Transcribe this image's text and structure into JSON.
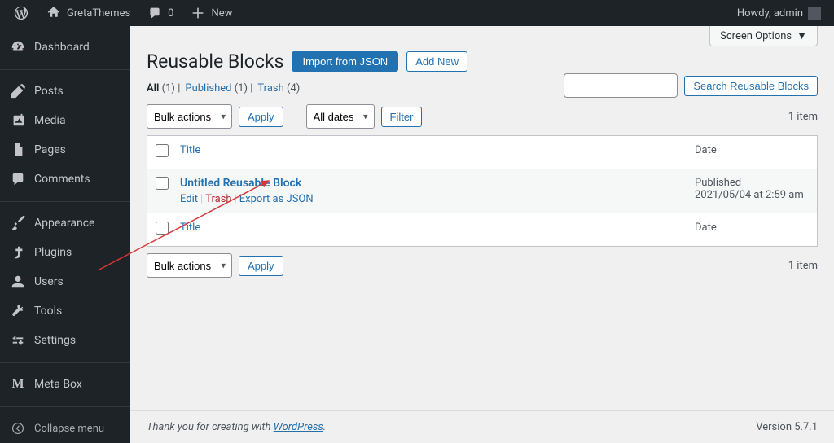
{
  "adminbar": {
    "site": "GretaThemes",
    "comments": "0",
    "new": "New",
    "howdy": "Howdy, admin"
  },
  "sidebar": {
    "items": [
      {
        "icon": "dashboard",
        "label": "Dashboard"
      },
      {
        "icon": "posts",
        "label": "Posts"
      },
      {
        "icon": "media",
        "label": "Media"
      },
      {
        "icon": "pages",
        "label": "Pages"
      },
      {
        "icon": "comments",
        "label": "Comments"
      },
      {
        "icon": "appearance",
        "label": "Appearance"
      },
      {
        "icon": "plugins",
        "label": "Plugins"
      },
      {
        "icon": "users",
        "label": "Users"
      },
      {
        "icon": "tools",
        "label": "Tools"
      },
      {
        "icon": "settings",
        "label": "Settings"
      },
      {
        "icon": "metabox",
        "label": "Meta Box"
      }
    ],
    "collapse": "Collapse menu"
  },
  "screen_options": "Screen Options",
  "page": {
    "title": "Reusable Blocks",
    "import_btn": "Import from JSON",
    "add_new_btn": "Add New"
  },
  "search": {
    "button": "Search Reusable Blocks"
  },
  "views": {
    "all": "All",
    "all_count": "(1)",
    "published": "Published",
    "published_count": "(1)",
    "trash": "Trash",
    "trash_count": "(4)"
  },
  "bulk": {
    "label": "Bulk actions",
    "apply": "Apply"
  },
  "dates": {
    "all": "All dates"
  },
  "filter_btn": "Filter",
  "item_count": "1 item",
  "table": {
    "col_title": "Title",
    "col_date": "Date",
    "rows": [
      {
        "title": "Untitled Reusable Block",
        "status": "Published",
        "date": "2021/05/04 at 2:59 am",
        "actions": {
          "edit": "Edit",
          "trash": "Trash",
          "export": "Export as JSON"
        }
      }
    ]
  },
  "footer": {
    "thanks_pre": "Thank you for creating with ",
    "wp": "WordPress",
    "thanks_post": ".",
    "version": "Version 5.7.1"
  }
}
